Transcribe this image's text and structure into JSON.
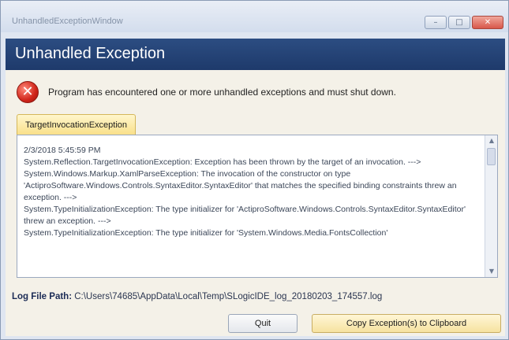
{
  "window": {
    "title": "UnhandledExceptionWindow",
    "btn_min": "–",
    "btn_max": "□",
    "btn_close": "✕"
  },
  "header": {
    "title": "Unhandled Exception"
  },
  "error": {
    "icon": "error-icon",
    "icon_glyph": "✕",
    "message": "Program has encountered one or more unhandled exceptions and must shut down."
  },
  "tab": {
    "label": "TargetInvocationException"
  },
  "log": {
    "text": "2/3/2018 5:45:59 PM\nSystem.Reflection.TargetInvocationException: Exception has been thrown by the target of an invocation. ---> System.Windows.Markup.XamlParseException: The invocation of the constructor on type 'ActiproSoftware.Windows.Controls.SyntaxEditor.SyntaxEditor' that matches the specified binding constraints threw an exception. --->\nSystem.TypeInitializationException: The type initializer for 'ActiproSoftware.Windows.Controls.SyntaxEditor.SyntaxEditor' threw an exception. --->\nSystem.TypeInitializationException: The type initializer for 'System.Windows.Media.FontsCollection'"
  },
  "logpath": {
    "label": "Log File Path:",
    "value": "C:\\Users\\74685\\AppData\\Local\\Temp\\SLogicIDE_log_20180203_174557.log"
  },
  "buttons": {
    "quit": "Quit",
    "copy": "Copy Exception(s) to Clipboard"
  },
  "colors": {
    "header_bg": "#1e3a6b",
    "content_bg": "#f4f1e8",
    "tab_bg": "#f9e08a",
    "error_red": "#d0251a"
  }
}
